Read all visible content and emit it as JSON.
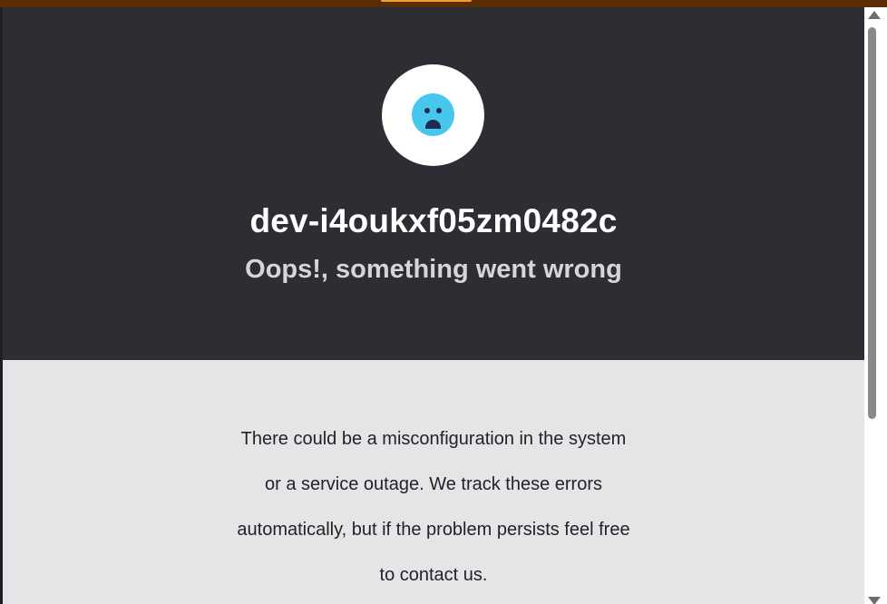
{
  "theme": {
    "hero_bg": "#2d2d34",
    "content_bg": "#e4e5e7",
    "top_strip": "#5a2d05",
    "face_color": "#47c6ee",
    "face_features": "#1f2b4f"
  },
  "hero": {
    "icon": "sad-face-icon",
    "title": "dev-i4oukxf05zm0482c",
    "subtitle": "Oops!, something went wrong"
  },
  "message": {
    "lines": [
      "There could be a misconfiguration in the system",
      "or a service outage. We track these errors",
      "automatically, but if the problem persists feel free",
      "to contact us."
    ]
  },
  "scrollbar": {
    "up_icon": "scroll-up-arrow-icon",
    "down_icon": "scroll-down-arrow-icon"
  }
}
